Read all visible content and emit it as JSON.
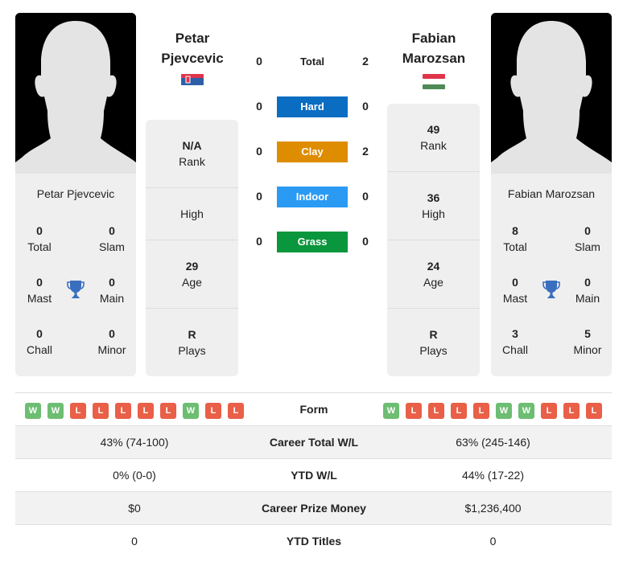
{
  "players": {
    "left": {
      "name_first": "Petar",
      "name_last": "Pjevcevic",
      "full_name": "Petar Pjevcevic",
      "country": "Serbia",
      "flag_colors": [
        "#e0344b",
        "#2c5fa8",
        "#ffffff"
      ],
      "titles": {
        "total": {
          "value": "0",
          "label": "Total"
        },
        "slam": {
          "value": "0",
          "label": "Slam"
        },
        "mast": {
          "value": "0",
          "label": "Mast"
        },
        "main": {
          "value": "0",
          "label": "Main"
        },
        "chall": {
          "value": "0",
          "label": "Chall"
        },
        "minor": {
          "value": "0",
          "label": "Minor"
        }
      },
      "profile": {
        "rank": {
          "value": "N/A",
          "label": "Rank"
        },
        "high": {
          "value": "",
          "label": "High"
        },
        "age": {
          "value": "29",
          "label": "Age"
        },
        "plays": {
          "value": "R",
          "label": "Plays"
        }
      },
      "form": [
        "W",
        "W",
        "L",
        "L",
        "L",
        "L",
        "L",
        "W",
        "L",
        "L"
      ]
    },
    "right": {
      "name_first": "Fabian",
      "name_last": "Marozsan",
      "full_name": "Fabian Marozsan",
      "country": "Hungary",
      "flag_colors": [
        "#e0344b",
        "#ffffff",
        "#4e8a55"
      ],
      "titles": {
        "total": {
          "value": "8",
          "label": "Total"
        },
        "slam": {
          "value": "0",
          "label": "Slam"
        },
        "mast": {
          "value": "0",
          "label": "Mast"
        },
        "main": {
          "value": "0",
          "label": "Main"
        },
        "chall": {
          "value": "3",
          "label": "Chall"
        },
        "minor": {
          "value": "5",
          "label": "Minor"
        }
      },
      "profile": {
        "rank": {
          "value": "49",
          "label": "Rank"
        },
        "high": {
          "value": "36",
          "label": "High"
        },
        "age": {
          "value": "24",
          "label": "Age"
        },
        "plays": {
          "value": "R",
          "label": "Plays"
        }
      },
      "form": [
        "W",
        "L",
        "L",
        "L",
        "L",
        "W",
        "W",
        "L",
        "L",
        "L"
      ]
    }
  },
  "h2h": [
    {
      "label": "Total",
      "left": "0",
      "right": "2",
      "color": ""
    },
    {
      "label": "Hard",
      "left": "0",
      "right": "0",
      "color": "#0a6dc2"
    },
    {
      "label": "Clay",
      "left": "0",
      "right": "2",
      "color": "#de8c00"
    },
    {
      "label": "Indoor",
      "left": "0",
      "right": "0",
      "color": "#2b9af3"
    },
    {
      "label": "Grass",
      "left": "0",
      "right": "0",
      "color": "#0a963c"
    }
  ],
  "comparison": {
    "form_label": "Form",
    "rows": [
      {
        "label": "Career Total W/L",
        "left": "43% (74-100)",
        "right": "63% (245-146)"
      },
      {
        "label": "YTD W/L",
        "left": "0% (0-0)",
        "right": "44% (17-22)"
      },
      {
        "label": "Career Prize Money",
        "left": "$0",
        "right": "$1,236,400"
      },
      {
        "label": "YTD Titles",
        "left": "0",
        "right": "0"
      }
    ]
  },
  "colors": {
    "win": "#6dbd72",
    "loss": "#e95f47",
    "trophy": "#3a6fbf",
    "card_bg": "#efefef"
  }
}
